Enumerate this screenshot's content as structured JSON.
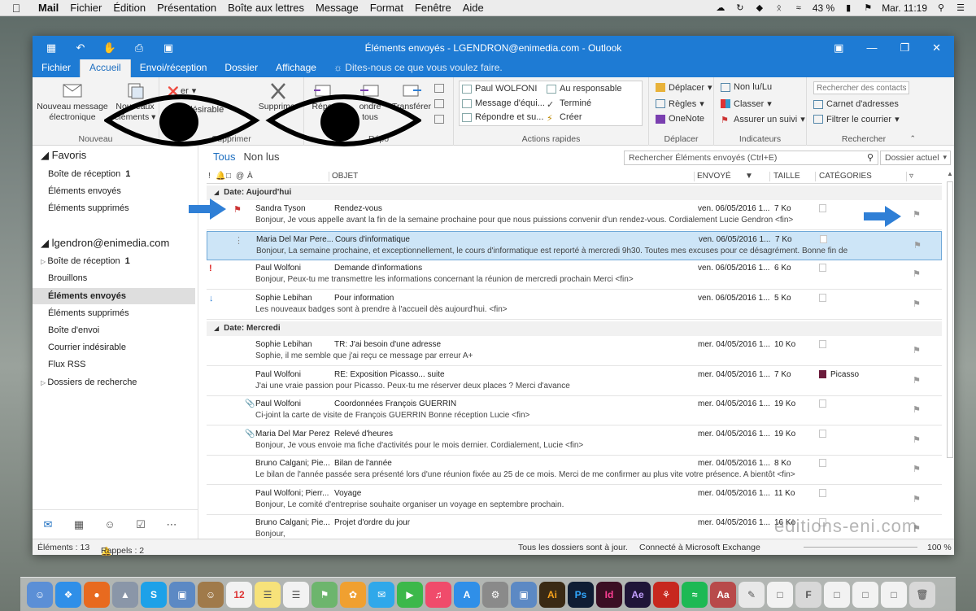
{
  "menubar": {
    "apple": "",
    "items": [
      "Mail",
      "Fichier",
      "Édition",
      "Présentation",
      "Boîte aux lettres",
      "Message",
      "Format",
      "Fenêtre",
      "Aide"
    ],
    "battery": "43 %",
    "clock": "Mar. 11:19"
  },
  "window": {
    "title": "Éléments envoyés - LGENDRON@enimedia.com - Outlook",
    "tabs": [
      "Fichier",
      "Accueil",
      "Envoi/réception",
      "Dossier",
      "Affichage"
    ],
    "tellme": "Dites-nous ce que vous voulez faire."
  },
  "ribbon": {
    "nouveau": {
      "new_mail_l1": "Nouveau message",
      "new_mail_l2": "électronique",
      "new_items_l1": "Nouveaux",
      "new_items_l2": "éléments",
      "label": "Nouveau"
    },
    "supprimer": {
      "ignore": "er",
      "junk": "indésirable",
      "delete": "Supprimer",
      "label": "Supprimer"
    },
    "repondre": {
      "reply": "Répo",
      "reply_all_l1": "ondre",
      "reply_all_l2": "tous",
      "forward": "Transférer",
      "label": "Répo"
    },
    "quicksteps": {
      "items": [
        "Paul WOLFONI",
        "Au responsable",
        "Message d'équi...",
        "Terminé",
        "Répondre et su...",
        "Créer"
      ],
      "label": "Actions rapides"
    },
    "deplacer": {
      "move": "Déplacer",
      "rules": "Règles",
      "onenote": "OneNote",
      "label": "Déplacer"
    },
    "indicateurs": {
      "unread": "Non lu/Lu",
      "categorize": "Classer",
      "followup": "Assurer un suivi",
      "label": "Indicateurs"
    },
    "rechercher": {
      "contacts_placeholder": "Rechercher des contacts",
      "address_book": "Carnet d'adresses",
      "filter": "Filtrer le courrier",
      "label": "Rechercher"
    }
  },
  "folders": {
    "favorites_header": "Favoris",
    "favorites": [
      {
        "label": "Boîte de réception",
        "count": "1"
      },
      {
        "label": "Éléments envoyés",
        "count": ""
      },
      {
        "label": "Éléments supprimés",
        "count": ""
      }
    ],
    "account": "lgendron@enimedia.com",
    "account_items": [
      {
        "label": "Boîte de réception",
        "count": "1"
      },
      {
        "label": "Brouillons",
        "count": ""
      },
      {
        "label": "Éléments envoyés",
        "count": ""
      },
      {
        "label": "Éléments supprimés",
        "count": ""
      },
      {
        "label": "Boîte d'envoi",
        "count": ""
      },
      {
        "label": "Courrier indésirable",
        "count": ""
      },
      {
        "label": "Flux RSS",
        "count": ""
      },
      {
        "label": "Dossiers de recherche",
        "count": ""
      }
    ]
  },
  "list": {
    "filter_all": "Tous",
    "filter_unread": "Non lus",
    "search_placeholder": "Rechercher Éléments envoyés (Ctrl+E)",
    "scope": "Dossier actuel",
    "columns": {
      "to": "À",
      "subject": "OBJET",
      "sent": "ENVOYÉ",
      "size": "TAILLE",
      "categories": "CATÉGORIES"
    },
    "groups": [
      {
        "label": "Date: Aujourd'hui",
        "messages": [
          {
            "from": "Sandra Tyson",
            "subject": "Rendez-vous",
            "date": "ven. 06/05/2016 1...",
            "size": "7 Ko",
            "category": "",
            "preview": "Bonjour,  Je vous appelle avant la fin de la semaine prochaine pour que nous puissions convenir d'un rendez-vous.  Cordialement  Lucie Gendron <fin>",
            "indicator": "flag-red",
            "selected": false
          },
          {
            "from": "Maria Del Mar Pere...",
            "subject": "Cours d'informatique",
            "date": "ven. 06/05/2016 1...",
            "size": "7 Ko",
            "category": "",
            "preview": "Bonjour,  La semaine prochaine, et exceptionnellement, le cours d'informatique est reporté à mercredi 9h30.  Toutes mes excuses pour ce désagrément.  Bonne fin de",
            "indicator": "",
            "selected": true
          },
          {
            "from": "Paul Wolfoni",
            "subject": "Demande d'informations",
            "date": "ven. 06/05/2016 1...",
            "size": "6 Ko",
            "category": "",
            "preview": "Bonjour,  Peux-tu me transmettre les informations concernant la réunion de mercredi prochain  Merci <fin>",
            "indicator": "high",
            "selected": false
          },
          {
            "from": "Sophie Lebihan",
            "subject": "Pour information",
            "date": "ven. 06/05/2016 1...",
            "size": "5 Ko",
            "category": "",
            "preview": "Les nouveaux badges sont à prendre à l'accueil dès aujourd'hui. <fin>",
            "indicator": "low",
            "selected": false
          }
        ]
      },
      {
        "label": "Date: Mercredi",
        "messages": [
          {
            "from": "Sophie Lebihan",
            "subject": "TR: J'ai besoin d'une adresse",
            "date": "mer. 04/05/2016 1...",
            "size": "10 Ko",
            "category": "",
            "preview": "Sophie, il me semble que j'ai reçu ce message par erreur  A+",
            "indicator": "",
            "selected": false
          },
          {
            "from": "Paul Wolfoni",
            "subject": "RE: Exposition Picasso... suite",
            "date": "mer. 04/05/2016 1...",
            "size": "7 Ko",
            "category": "Picasso",
            "preview": "J'ai une vraie passion pour Picasso. Peux-tu me réserver deux places ?  Merci d'avance",
            "indicator": "",
            "selected": false
          },
          {
            "from": "Paul Wolfoni",
            "subject": "Coordonnées François GUERRIN",
            "date": "mer. 04/05/2016 1...",
            "size": "19 Ko",
            "category": "",
            "preview": "Ci-joint la carte de visite de François GUERRIN  Bonne réception  Lucie <fin>",
            "indicator": "attach",
            "selected": false
          },
          {
            "from": "Maria Del Mar Perez",
            "subject": "Relevé d'heures",
            "date": "mer. 04/05/2016 1...",
            "size": "19 Ko",
            "category": "",
            "preview": "Bonjour,  Je vous envoie ma fiche d'activités pour le mois dernier.  Cordialement,  Lucie <fin>",
            "indicator": "attach",
            "selected": false
          },
          {
            "from": "Bruno Calgani; Pie...",
            "subject": "Bilan de l'année",
            "date": "mer. 04/05/2016 1...",
            "size": "8 Ko",
            "category": "",
            "preview": "Le bilan de l'année passée sera présenté lors d'une réunion fixée au 25 de ce mois.  Merci de me confirmer au plus vite votre présence.  A bientôt <fin>",
            "indicator": "",
            "selected": false
          },
          {
            "from": "Paul Wolfoni; Pierr...",
            "subject": "Voyage",
            "date": "mer. 04/05/2016 1...",
            "size": "11 Ko",
            "category": "",
            "preview": "Bonjour,  Le comité d'entreprise souhaite organiser un voyage en septembre prochain.",
            "indicator": "",
            "selected": false
          },
          {
            "from": "Bruno Calgani; Pie...",
            "subject": "Projet d'ordre du jour",
            "date": "mer. 04/05/2016 1...",
            "size": "16 Ko",
            "category": "",
            "preview": "Bonjour,",
            "indicator": "",
            "selected": false
          }
        ]
      }
    ]
  },
  "status": {
    "items": "Éléments : 13",
    "reminders": "Rappels : 2",
    "sync": "Tous les dossiers sont à jour.",
    "connection": "Connecté à Microsoft Exchange",
    "zoom": "100 %"
  },
  "watermark": "editions-eni.com",
  "colors": {
    "accent": "#1e7bd4",
    "selected_row": "#cde5f7",
    "picasso": "#6b1b3b",
    "arrow": "#2f7fd6"
  }
}
